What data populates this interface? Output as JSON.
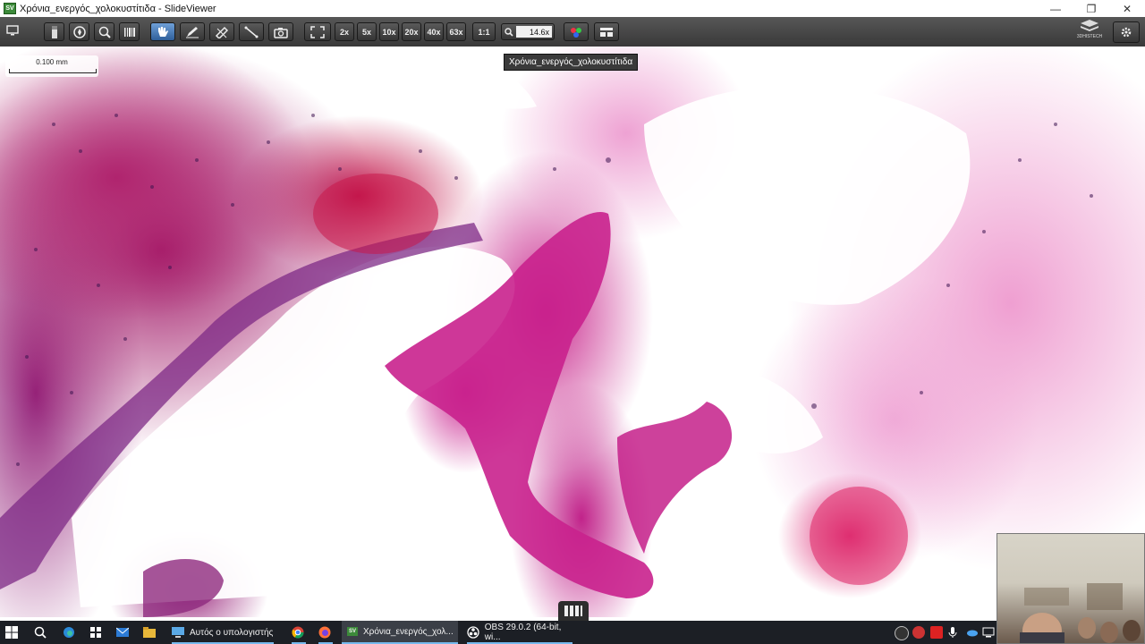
{
  "window": {
    "title": "Χρόνια_ενεργός_χολοκυστίτιδα - SlideViewer",
    "app_icon_text": "SV",
    "controls": [
      "minimize-icon",
      "restore-icon",
      "close-icon"
    ]
  },
  "toolbar": {
    "left_icon": "monitor-icon",
    "tools": [
      {
        "name": "slide-holder-icon"
      },
      {
        "name": "navigator-icon"
      },
      {
        "name": "magnifier-icon"
      },
      {
        "name": "barcode-icon"
      },
      {
        "name": "pan-hand-icon",
        "active": true
      },
      {
        "name": "pen-icon"
      },
      {
        "name": "annotation-icon"
      },
      {
        "name": "measure-icon"
      },
      {
        "name": "camera-icon"
      },
      {
        "name": "fit-screen-icon"
      }
    ],
    "magnifications": [
      "2x",
      "5x",
      "10x",
      "20x",
      "40x",
      "63x",
      "1:1"
    ],
    "zoom_value": "14.6x",
    "right_icons": [
      "color-adjust-icon",
      "layout-icon"
    ],
    "brand": "3DHISTECH",
    "settings_icon": "settings-icon"
  },
  "scale_bar": {
    "label": "0.100 mm"
  },
  "tooltip": {
    "text": "Χρόνια_ενεργός_χολοκυστίτιδα"
  },
  "taskbar": {
    "start_icon": "windows-icon",
    "search_icon": "search-icon",
    "pinned": [
      "edge-icon",
      "store-icon",
      "mail-icon",
      "explorer-icon"
    ],
    "apps": [
      {
        "label": "Αυτός ο υπολογιστής",
        "icon": "computer-icon"
      },
      {
        "label": "",
        "icon": "chrome-icon"
      },
      {
        "label": "",
        "icon": "firefox-icon"
      },
      {
        "label": "Χρόνια_ενεργός_χολ...",
        "icon": "slideviewer-icon",
        "active": true
      },
      {
        "label": "OBS 29.0.2 (64-bit, wi...",
        "icon": "obs-icon"
      }
    ],
    "tray": [
      "obs-tray-icon",
      "app-tray-icon-1",
      "app-tray-icon-2",
      "microphone-icon",
      "network-icon",
      "cloud-icon",
      "notification-icon"
    ]
  },
  "colors": {
    "toolbar": "#333333",
    "taskbar": "#1c1f25",
    "accent": "#76b9ed",
    "tissue_dark": "#a11a68",
    "tissue_light": "#ef9fd1"
  }
}
